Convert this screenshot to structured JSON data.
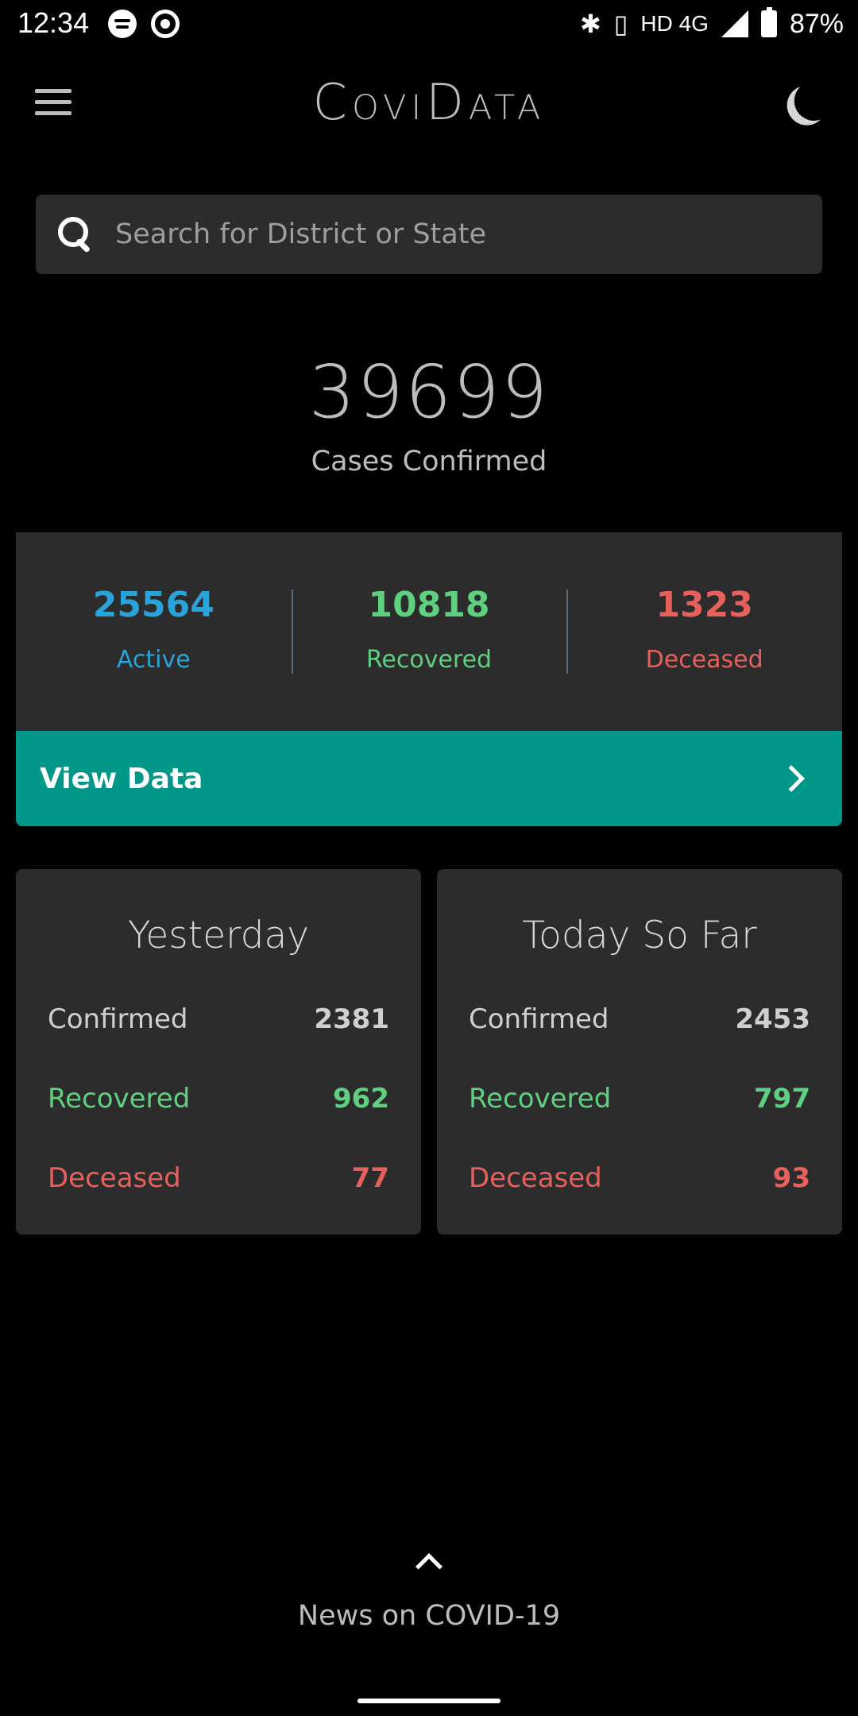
{
  "status_bar": {
    "time": "12:34",
    "network": "HD 4G",
    "battery": "87%"
  },
  "app": {
    "title": "CoviData"
  },
  "search": {
    "placeholder": "Search for District or State"
  },
  "headline": {
    "count": "39699",
    "label": "Cases Confirmed"
  },
  "summary": {
    "active": {
      "value": "25564",
      "label": "Active"
    },
    "recovered": {
      "value": "10818",
      "label": "Recovered"
    },
    "deceased": {
      "value": "1323",
      "label": "Deceased"
    }
  },
  "view_data": {
    "label": "View Data"
  },
  "yesterday": {
    "title": "Yesterday",
    "confirmed": {
      "label": "Confirmed",
      "value": "2381"
    },
    "recovered": {
      "label": "Recovered",
      "value": "962"
    },
    "deceased": {
      "label": "Deceased",
      "value": "77"
    }
  },
  "today": {
    "title": "Today So Far",
    "confirmed": {
      "label": "Confirmed",
      "value": "2453"
    },
    "recovered": {
      "label": "Recovered",
      "value": "797"
    },
    "deceased": {
      "label": "Deceased",
      "value": "93"
    }
  },
  "news": {
    "label": "News on COVID-19"
  },
  "colors": {
    "active": "#29a3d9",
    "recovered": "#5fd07f",
    "deceased": "#e8605c",
    "accent": "#009688",
    "card": "#2c2c2c"
  }
}
